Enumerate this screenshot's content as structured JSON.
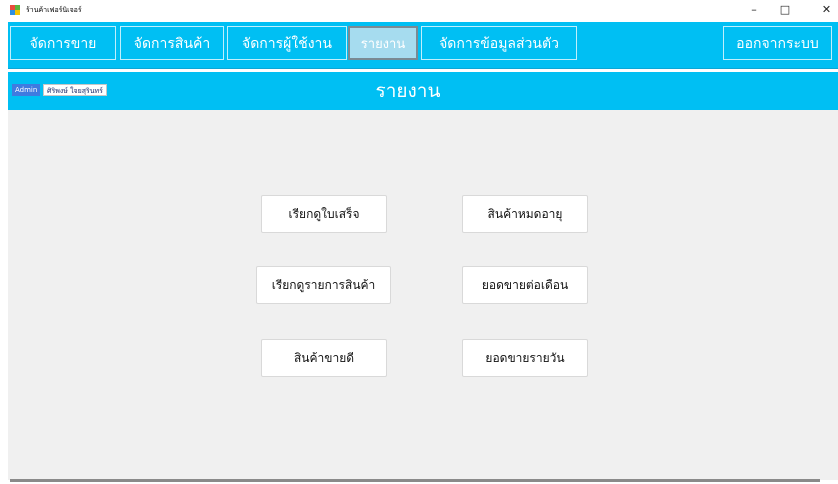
{
  "window": {
    "title": "ร้านค้าเฟอร์นิเจอร์",
    "controls": {
      "minimize": "–",
      "maximize": "□",
      "close": "✕"
    }
  },
  "menu": {
    "sale": "จัดการขาย",
    "product": "จัดการสินค้า",
    "users": "จัดการผู้ใช้งาน",
    "report": "รายงาน",
    "profile": "จัดการข้อมูลส่วนตัว",
    "logout": "ออกจากระบบ"
  },
  "header": {
    "role": "Admin",
    "user_name": "ศิริพงษ์ ใจยสุรินทร์",
    "title": "รายงาน"
  },
  "reports": {
    "receipt": "เรียกดูใบเสร็จ",
    "expired": "สินค้าหมดอายุ",
    "product_list": "เรียกดูรายการสินค้า",
    "monthly_sales": "ยอดขายต่อเดือน",
    "best_seller": "สินค้าขายดี",
    "daily_sales": "ยอดขายรายวัน"
  },
  "colors": {
    "accent": "#00bff3",
    "active_tab": "#a6dcef",
    "admin_badge": "#3f7be0",
    "content_bg": "#f0f0f0"
  }
}
